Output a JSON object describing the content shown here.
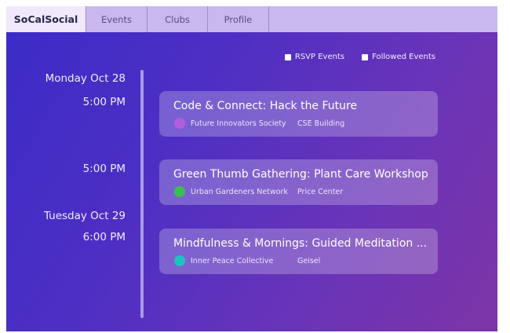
{
  "nav": {
    "brand": "SoCalSocial",
    "items": [
      "Events",
      "Clubs",
      "Profile"
    ]
  },
  "filters": {
    "rsvp": "RSVP Events",
    "followed": "Followed Events"
  },
  "timeline": {
    "days": [
      "Monday Oct 28",
      "Tuesday Oct 29"
    ],
    "times": [
      "5:00 PM",
      "5:00 PM",
      "6:00 PM"
    ]
  },
  "events": [
    {
      "title": "Code & Connect: Hack the Future",
      "club": "Future Innovators Society",
      "location": "CSE Building",
      "dot_color": "#b15ddb"
    },
    {
      "title": "Green Thumb Gathering: Plant Care Workshop",
      "club": "Urban Gardeners Network",
      "location": "Price Center",
      "dot_color": "#3bbf4e"
    },
    {
      "title": "Mindfulness & Mornings: Guided Meditation ...",
      "club": "Inner Peace Collective",
      "location": "Geisel",
      "dot_color": "#1ec2c0"
    }
  ],
  "colors": {
    "nav_bg": "#c9b8ef",
    "brand_bg": "#efe9fb",
    "bg_start": "#3b2bc7",
    "bg_end": "#7d35a6"
  }
}
